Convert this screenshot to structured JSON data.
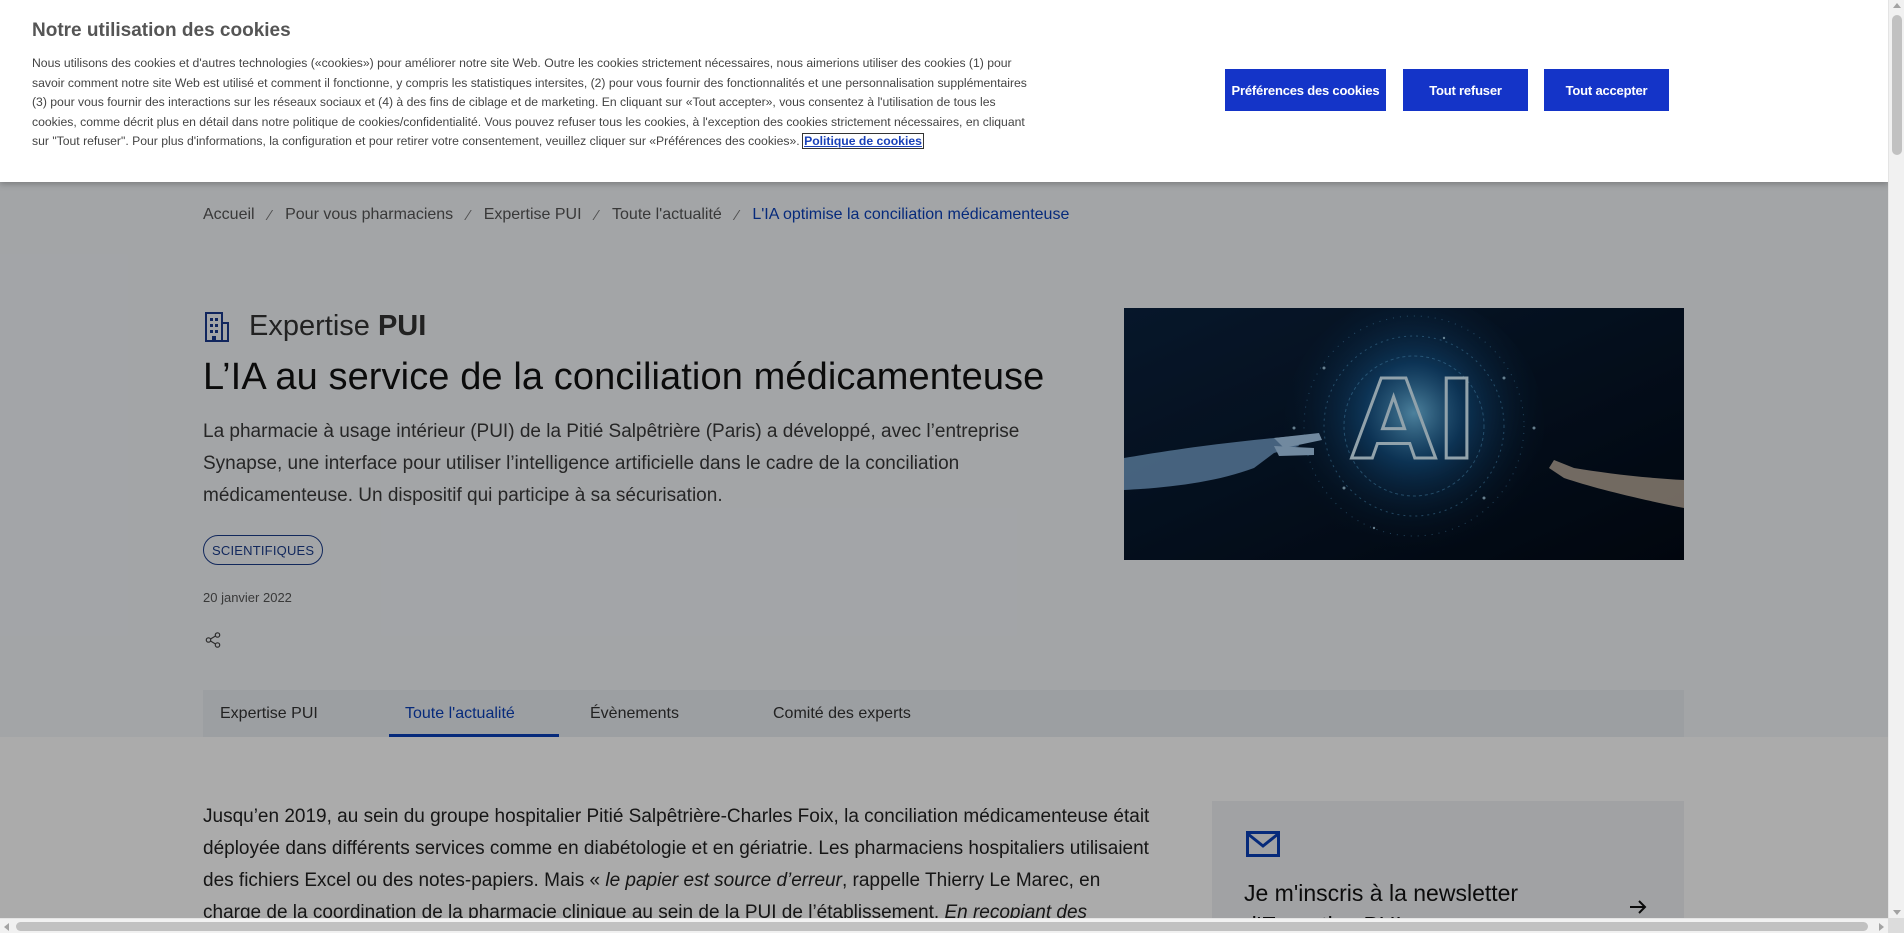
{
  "cookie_banner": {
    "title": "Notre utilisation des cookies",
    "text": "Nous utilisons des cookies et d'autres technologies («cookies») pour améliorer notre site Web. Outre les cookies strictement nécessaires, nous aimerions utiliser des cookies (1) pour savoir comment notre site Web est utilisé et comment il fonctionne, y compris les statistiques intersites, (2) pour vous fournir des fonctionnalités et une personnalisation supplémentaires (3) pour vous fournir des interactions sur les réseaux sociaux et (4) à des fins de ciblage et de marketing. En cliquant sur «Tout accepter», vous consentez à l'utilisation de tous les cookies, comme décrit plus en détail dans notre politique de cookies/confidentialité. Vous pouvez refuser tous les cookies, à l'exception des cookies strictement nécessaires, en cliquant sur \"Tout refuser\". Pour plus d'informations, la configuration et pour retirer votre consentement, veuillez cliquer sur «Préférences des cookies».",
    "policy_link": "Politique de cookies",
    "btn_preferences": "Préférences des cookies",
    "btn_refuse": "Tout refuser",
    "btn_accept": "Tout accepter",
    "accent_color": "#1434c8"
  },
  "breadcrumb": {
    "items": [
      "Accueil",
      "Pour vous pharmaciens",
      "Expertise PUI",
      "Toute l'actualité"
    ],
    "current": "L'IA optimise la conciliation médicamenteuse",
    "separator": "⁄"
  },
  "section": {
    "icon": "building-icon",
    "label_light": "Expertise",
    "label_bold": "PUI"
  },
  "article": {
    "title": "L’IA au service de la conciliation médicamenteuse",
    "lead": "La pharmacie à usage intérieur (PUI) de la Pitié Salpêtrière (Paris) a développé, avec l’entreprise Synapse, une interface pour utiliser l’intelligence artificielle dans le cadre de la conciliation médicamenteuse. Un dispositif qui participe à sa sécurisation.",
    "tag": "SCIENTIFIQUES",
    "date": "20 janvier 2022",
    "share_icon": "share-icon",
    "image_text": "AI"
  },
  "tabs": [
    {
      "label": "Expertise PUI",
      "active": false
    },
    {
      "label": "Toute l'actualité",
      "active": true
    },
    {
      "label": "Évènements",
      "active": false
    },
    {
      "label": "Comité des experts",
      "active": false
    }
  ],
  "body": {
    "p1": "Jusqu’en 2019, au sein du groupe hospitalier Pitié Salpêtrière-Charles Foix, la conciliation médicamenteuse était déployée dans différents services comme en diabétologie et en gériatrie. Les pharmaciens hospitaliers utilisaient des fichiers Excel ou des notes-papiers. Mais « ",
    "quote1": "le papier est source d’erreur",
    "p2": ", rappelle Thierry Le Marec, en charge de la coordination de la pharmacie clinique au sein de la PUI de l’établissement. ",
    "quote2": "En recopiant des données, il y a toujours un"
  },
  "newsletter": {
    "title": "Je m'inscris à la newsletter d'Expertise PUI",
    "icon": "mail-icon"
  }
}
